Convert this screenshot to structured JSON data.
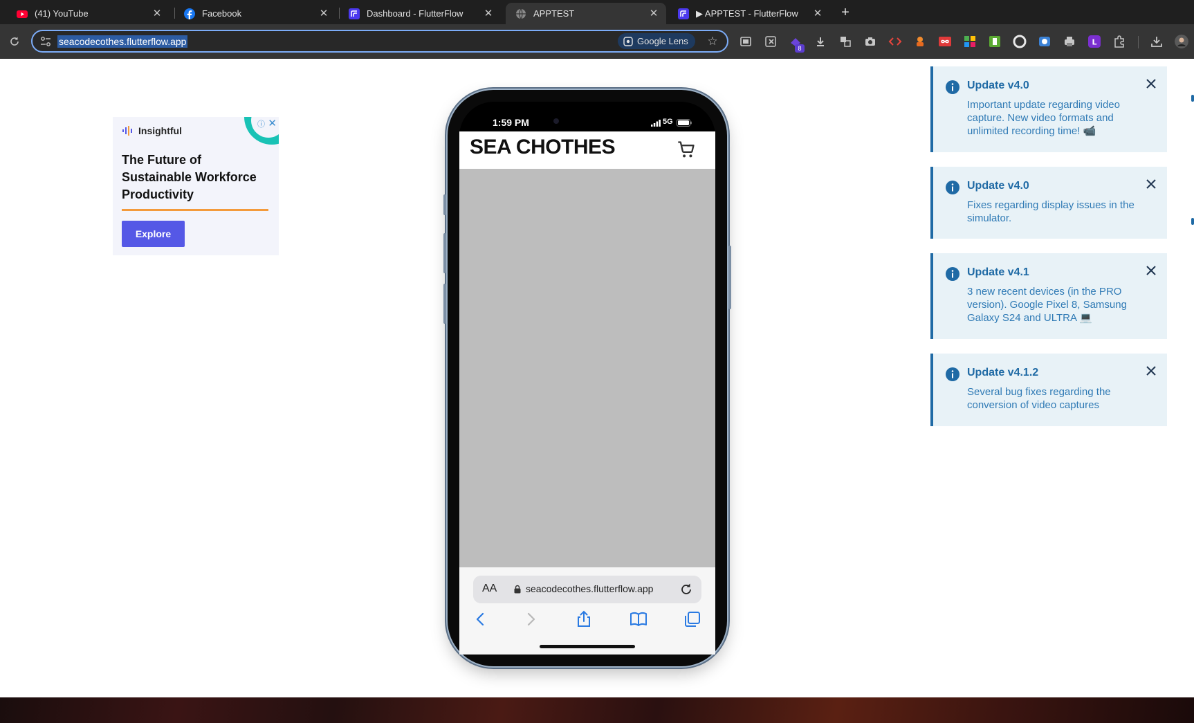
{
  "browser": {
    "tabs": [
      {
        "title": "(41) YouTube",
        "icon": "youtube-icon",
        "active": false
      },
      {
        "title": "Facebook",
        "icon": "facebook-icon",
        "active": false
      },
      {
        "title": "Dashboard - FlutterFlow",
        "icon": "flutterflow-icon",
        "active": false
      },
      {
        "title": "APPTEST",
        "icon": "globe-icon",
        "active": true
      },
      {
        "title": "▶ APPTEST - FlutterFlow",
        "icon": "flutterflow-icon",
        "active": false
      }
    ],
    "close_glyph": "✕",
    "new_tab_glyph": "+",
    "address": "seacodecothes.flutterflow.app",
    "lens_label": "Google Lens",
    "extension_badge": "8",
    "accent": "#7cacf8"
  },
  "ad": {
    "brand": "Insightful",
    "headline": "The Future of Sustainable Workforce Productivity",
    "cta": "Explore",
    "adchoices_glyph": "ⓘ",
    "close_glyph": "✕"
  },
  "phone": {
    "time": "1:59 PM",
    "network": "5G",
    "app_title": "SEA CHOTHES",
    "safari_aa": "AA",
    "safari_url": "seacodecothes.flutterflow.app"
  },
  "notifications": [
    {
      "title": "Update v4.0",
      "body": "Important update regarding video capture. New video formats and unlimited recording time! 📹"
    },
    {
      "title": "Update v4.0",
      "body": "Fixes regarding display issues in the simulator."
    },
    {
      "title": "Update v4.1",
      "body": "3 new recent devices (in the PRO version). Google Pixel 8, Samsung Galaxy S24 and ULTRA 💻"
    },
    {
      "title": "Update v4.1.2",
      "body": "Several bug fixes regarding the conversion of video captures"
    }
  ],
  "colors": {
    "notification_accent": "#1f6aa5",
    "notification_bg": "#e8f2f7",
    "ad_button": "#5558e6",
    "app_placeholder": "#bdbdbd"
  }
}
